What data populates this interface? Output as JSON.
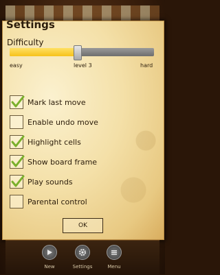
{
  "settings": {
    "title": "Settings",
    "difficulty_label": "Difficulty",
    "difficulty_value": 0.47,
    "ticks": {
      "min": "easy",
      "mid": "level 3",
      "max": "hard"
    },
    "options": [
      {
        "label": "Mark last move",
        "checked": true
      },
      {
        "label": "Enable undo move",
        "checked": false
      },
      {
        "label": "Highlight cells",
        "checked": true
      },
      {
        "label": "Show board frame",
        "checked": true
      },
      {
        "label": "Play sounds",
        "checked": true
      },
      {
        "label": "Parental control",
        "checked": false
      }
    ],
    "ok_label": "OK"
  },
  "toolbar": {
    "new_label": "New",
    "settings_label": "Settings",
    "menu_label": "Menu"
  },
  "colors": {
    "check": "#7ab02c",
    "slider_fill": "#f7c21a"
  }
}
